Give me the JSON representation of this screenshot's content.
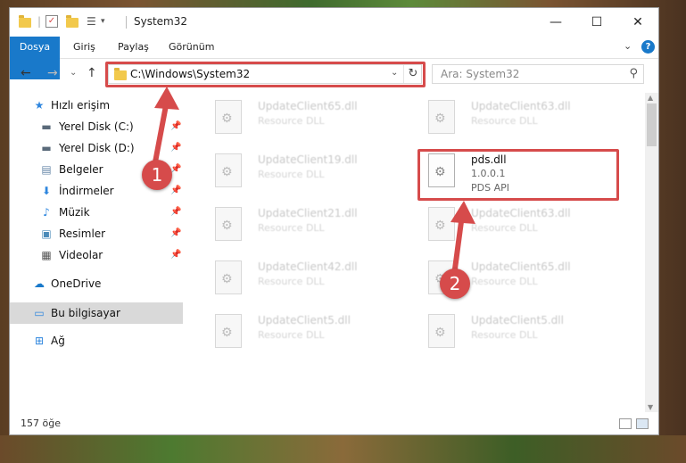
{
  "window": {
    "title": "System32"
  },
  "window_controls": {
    "minimize": "—",
    "maximize": "☐",
    "close": "✕"
  },
  "ribbon": {
    "tabs": [
      "Dosya",
      "Giriş",
      "Paylaş",
      "Görünüm"
    ],
    "expand": "⌄",
    "help": "?"
  },
  "navigation": {
    "back": "←",
    "forward": "→",
    "recent": "⌄",
    "up": "↑",
    "address": "C:\\Windows\\System32",
    "address_dropdown": "⌄",
    "refresh": "↻",
    "search_placeholder": "Ara: System32"
  },
  "sidebar": {
    "items": [
      {
        "label": "Hızlı erişim",
        "icon": "star-icon",
        "glyph": "★",
        "color": "#2e86de",
        "pinned": false
      },
      {
        "label": "Yerel Disk (C:)",
        "icon": "drive-icon",
        "glyph": "▬",
        "color": "#5a6a7a",
        "pinned": true
      },
      {
        "label": "Yerel Disk (D:)",
        "icon": "drive-icon",
        "glyph": "▬",
        "color": "#5a6a7a",
        "pinned": true
      },
      {
        "label": "Belgeler",
        "icon": "documents-icon",
        "glyph": "▤",
        "color": "#6a8aaa",
        "pinned": true
      },
      {
        "label": "İndirmeler",
        "icon": "download-icon",
        "glyph": "⬇",
        "color": "#2e86de",
        "pinned": true
      },
      {
        "label": "Müzik",
        "icon": "music-icon",
        "glyph": "♪",
        "color": "#2e86de",
        "pinned": true
      },
      {
        "label": "Resimler",
        "icon": "pictures-icon",
        "glyph": "▣",
        "color": "#4a8ab8",
        "pinned": true
      },
      {
        "label": "Videolar",
        "icon": "video-icon",
        "glyph": "▦",
        "color": "#555",
        "pinned": true
      },
      {
        "label": "OneDrive",
        "icon": "cloud-icon",
        "glyph": "☁",
        "color": "#1979ca",
        "pinned": false
      },
      {
        "label": "Bu bilgisayar",
        "icon": "computer-icon",
        "glyph": "▭",
        "color": "#2e86de",
        "pinned": false
      },
      {
        "label": "Ağ",
        "icon": "network-icon",
        "glyph": "⊞",
        "color": "#2e86de",
        "pinned": false
      }
    ],
    "pin_glyph": "📌"
  },
  "files": [
    {
      "name": "UpdateClient65.dll",
      "type": "Resource DLL"
    },
    {
      "name": "UpdateClient63.dll",
      "type": "Resource DLL"
    },
    {
      "name": "UpdateClient19.dll",
      "type": "Resource DLL"
    },
    {
      "name": "pds.dll",
      "version": "1.0.0.1",
      "type": "PDS API"
    },
    {
      "name": "UpdateClient21.dll",
      "type": "Resource DLL"
    },
    {
      "name": "UpdateClient63.dll",
      "type": "Resource DLL"
    },
    {
      "name": "UpdateClient42.dll",
      "type": "Resource DLL"
    },
    {
      "name": "UpdateClient65.dll",
      "type": "Resource DLL"
    },
    {
      "name": "UpdateClient5.dll",
      "type": "Resource DLL"
    },
    {
      "name": "UpdateClient5.dll",
      "type": "Resource DLL"
    }
  ],
  "annotations": {
    "step1": "1",
    "step2": "2",
    "color": "#d64b4b"
  },
  "status": {
    "count": "157 öğe"
  }
}
